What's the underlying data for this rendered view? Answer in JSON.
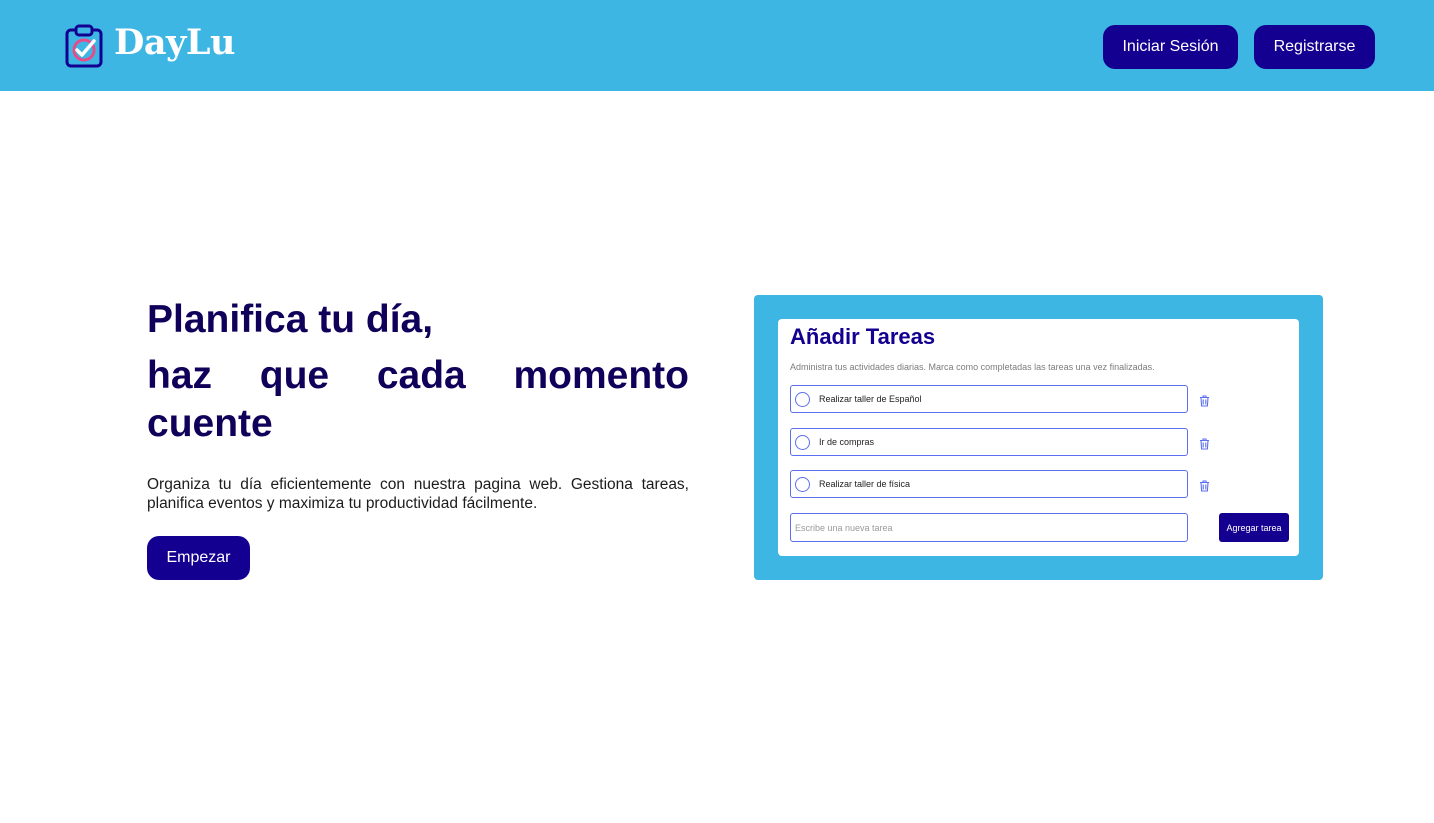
{
  "colors": {
    "header_bg": "#3db6e4",
    "button_bg": "#140090",
    "title_color": "#10005a",
    "accent_blue": "#5b6ff0"
  },
  "header": {
    "logo_icon": "clipboard-check-icon",
    "brand": "DayLu",
    "login_label": "Iniciar Sesión",
    "register_label": "Registrarse"
  },
  "hero": {
    "title_line1": "Planifica tu día,",
    "title_line2": "haz que cada momento cuente",
    "description": "Organiza tu día eficientemente con nuestra pagina web. Gestiona tareas, planifica eventos y maximiza tu productividad fácilmente.",
    "start_label": "Empezar"
  },
  "preview": {
    "title": "Añadir Tareas",
    "subtitle": "Administra tus actividades diarias. Marca como completadas las tareas una vez finalizadas.",
    "tasks": [
      {
        "label": "Realizar taller de Español",
        "completed": false
      },
      {
        "label": "Ir de compras",
        "completed": false
      },
      {
        "label": "Realizar taller de física",
        "completed": false
      }
    ],
    "trash_icon": "trash-icon",
    "input_placeholder": "Escribe una nueva tarea",
    "add_label": "Agregar tarea"
  }
}
